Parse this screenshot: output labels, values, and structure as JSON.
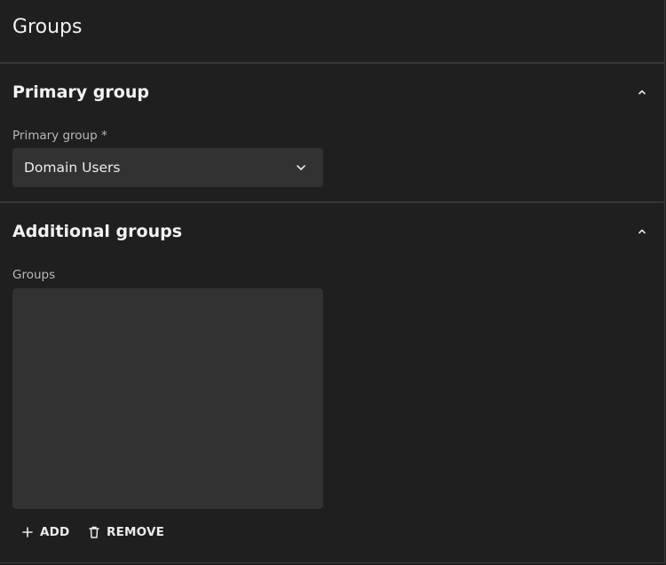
{
  "page": {
    "title": "Groups"
  },
  "primary_section": {
    "title": "Primary group",
    "field_label": "Primary group *",
    "selected_value": "Domain Users"
  },
  "additional_section": {
    "title": "Additional groups",
    "field_label": "Groups",
    "items": [],
    "add_label": "ADD",
    "remove_label": "REMOVE"
  },
  "icons": {
    "collapse": "chevron-up-icon",
    "dropdown": "chevron-down-icon",
    "add": "plus-icon",
    "remove": "trash-icon"
  },
  "colors": {
    "background": "#1f1f1f",
    "surface": "#323232",
    "text": "#ececec",
    "label": "#b8b8b8",
    "divider": "#363636"
  }
}
